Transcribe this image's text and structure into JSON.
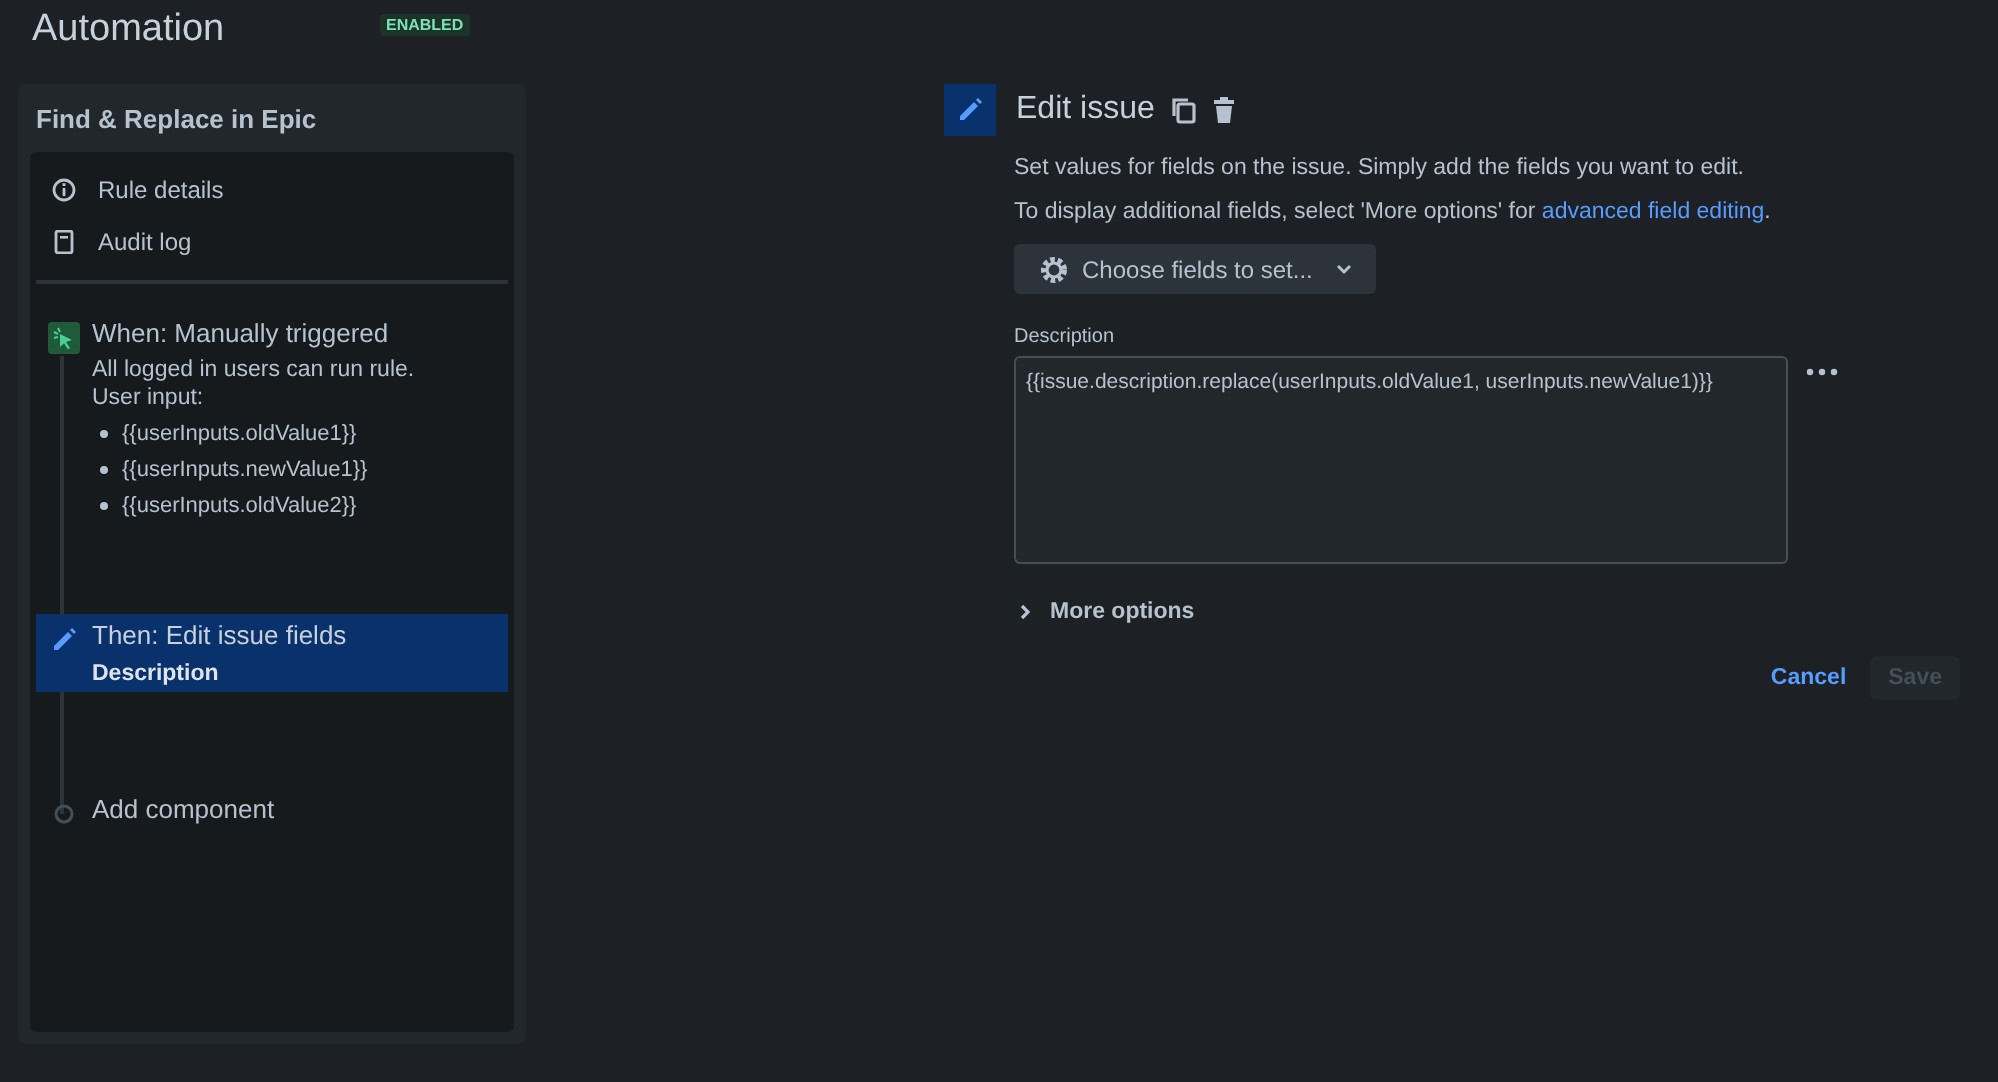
{
  "header": {
    "title": "Automation",
    "status_badge": "ENABLED"
  },
  "rule": {
    "name": "Find & Replace in Epic",
    "nav": [
      {
        "kind": "info",
        "label": "Rule details"
      },
      {
        "kind": "log",
        "label": "Audit log"
      }
    ],
    "steps": [
      {
        "kind": "trigger",
        "title": "When: Manually triggered",
        "selected": false,
        "text": "All logged in users can run rule.",
        "subtitle": "User input:",
        "inputs": [
          "{{userInputs.oldValue1}}",
          "{{userInputs.newValue1}}",
          "{{userInputs.oldValue2}}"
        ]
      },
      {
        "kind": "action",
        "title": "Then: Edit issue fields",
        "selected": true,
        "detail": "Description"
      },
      {
        "kind": "add",
        "title": "Add component",
        "selected": false
      }
    ]
  },
  "editor": {
    "title": "Edit issue",
    "intro": "Set values for fields on the issue. Simply add the fields you want to edit.",
    "hint": "To display additional fields, select 'More options' for ",
    "hint_link": "advanced field editing",
    "hint_end": ".",
    "choose_button": "Choose fields to set...",
    "field_label": "Description",
    "field_value": "{{issue.description.replace(userInputs.oldValue1, userInputs.newValue1)}}",
    "more_options": "More options",
    "more_expanded": false,
    "cancel": "Cancel",
    "save": {
      "label": "Save",
      "disabled": true
    }
  }
}
